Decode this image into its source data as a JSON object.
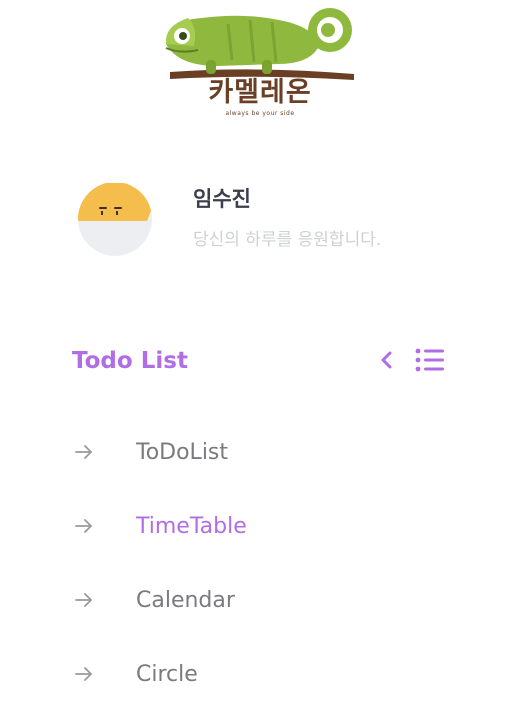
{
  "brand": {
    "logo_text": "카멜레온",
    "tagline": "always be your side",
    "logo_icon": "chameleon-icon"
  },
  "profile": {
    "name": "임수진",
    "message": "당신의 하루를 응원합니다.",
    "avatar_icon": "sleepy-face-icon"
  },
  "section": {
    "title": "Todo List",
    "collapse_icon": "chevron-left-icon",
    "menu_icon": "list-icon"
  },
  "nav": {
    "items": [
      {
        "label": "ToDoList",
        "active": false
      },
      {
        "label": "TimeTable",
        "active": true
      },
      {
        "label": "Calendar",
        "active": false
      },
      {
        "label": "Circle",
        "active": false
      }
    ],
    "arrow_icon": "arrow-right-icon"
  },
  "colors": {
    "accent": "#b06ee6",
    "nav_text": "#7a7a7f",
    "arrow": "#9a9a9e",
    "avatar_yellow": "#f5bd4b",
    "avatar_gray": "#eceef1",
    "logo_green": "#8fb93e",
    "logo_brown": "#6b3f26"
  }
}
